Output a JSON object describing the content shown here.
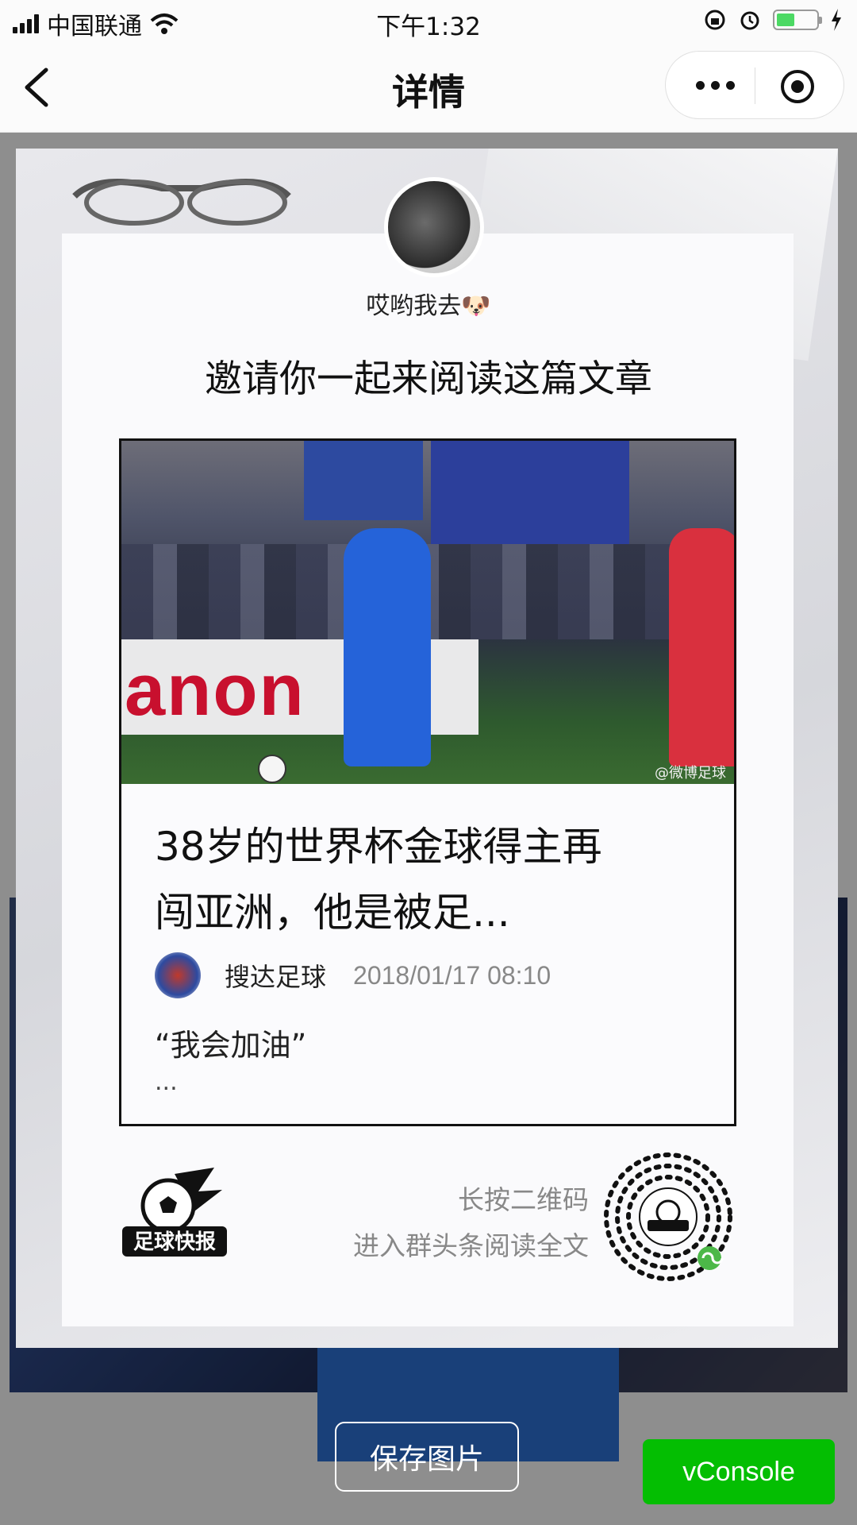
{
  "status_bar": {
    "carrier": "中国联通",
    "time": "下午1:32"
  },
  "nav": {
    "title": "详情"
  },
  "poster": {
    "username": "哎哟我去🐶",
    "invite_text": "邀请你一起来阅读这篇文章",
    "article": {
      "title_line1": "38岁的世界杯金球得主再",
      "title_line2": "闯亚洲，他是被足...",
      "author": "搜达足球",
      "timestamp": "2018/01/17 08:10",
      "excerpt": "“我会加油”",
      "ellipsis": "...",
      "photo_banner_text": "anon",
      "photo_watermark": "@微博足球"
    },
    "brand_logo_text": "足球快报",
    "qr_hint_line1": "长按二维码",
    "qr_hint_line2": "进入群头条阅读全文"
  },
  "actions": {
    "save_label": "保存图片",
    "vconsole_label": "vConsole"
  },
  "colors": {
    "vconsole_green": "#04be02",
    "battery_green": "#4cd964",
    "canon_red": "#c8102e"
  }
}
